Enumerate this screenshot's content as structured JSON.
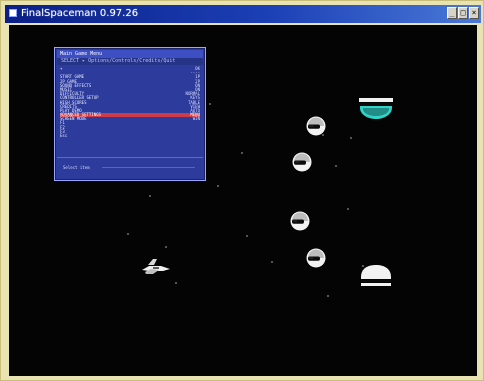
{
  "window": {
    "title": "FinalSpaceman 0.97.26",
    "minimize_glyph": "_",
    "maximize_glyph": "□",
    "close_glyph": "×"
  },
  "menu": {
    "header": "Main Game Menu",
    "subheader": "SELECT  ▸  Options/Controls/Credits/Quit",
    "rows": [
      {
        "label": "+",
        "value": "OK"
      },
      {
        "label": "",
        "value": "----"
      },
      {
        "label": "START GAME",
        "value": "1P"
      },
      {
        "label": "2P GAME",
        "value": "2P"
      },
      {
        "label": "SOUND EFFECTS",
        "value": "ON"
      },
      {
        "label": "MUSIC",
        "value": "ON"
      },
      {
        "label": "DIFFICULTY",
        "value": "NORMAL"
      },
      {
        "label": "CONTROLLER SETUP",
        "value": "KEYS"
      },
      {
        "label": "HIGH SCORES",
        "value": "TABLE"
      },
      {
        "label": "CREDITS",
        "value": "VIEW"
      },
      {
        "label": "PLAY DEMO",
        "value": "AUTO"
      },
      {
        "label": "ADVANCED SETTINGS",
        "value": "MENU"
      },
      {
        "label": "SCREEN MODE",
        "value": "WIN"
      },
      {
        "label": "F1",
        "value": ""
      },
      {
        "label": "F2",
        "value": ""
      },
      {
        "label": "F3",
        "value": ""
      },
      {
        "label": "Esc",
        "value": ""
      }
    ],
    "selected_index": 11,
    "footer": "Select item"
  },
  "game": {
    "player_ship_icon": "player-ship-icon",
    "enemy_icon": "helmet-enemy-icon",
    "dome_icon": "dome-bunker-icon",
    "colors": {
      "background": "#040404",
      "menu_panel": "#2c3b9c",
      "menu_highlight": "#cf3c47",
      "dome_glow": "#2fd3c8",
      "enemy": "#f2f2f2"
    }
  }
}
